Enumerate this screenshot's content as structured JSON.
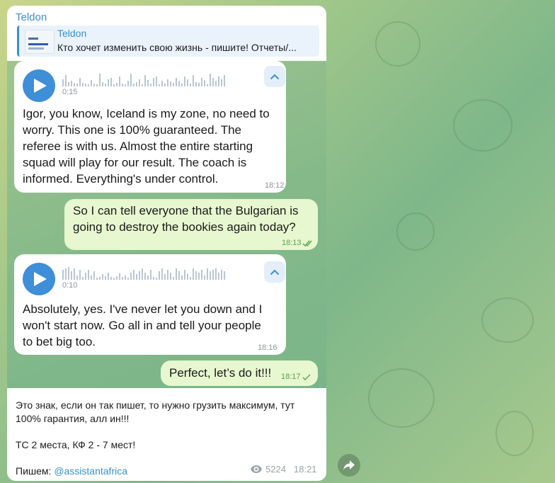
{
  "post": {
    "channel": "Teldon",
    "quote_title": "Teldon",
    "quote_text": "Кто хочет изменить свою жизнь - пишите!  Отчеты/...",
    "body_line1": "Это знак, если он так пишет, то нужно грузить максимум, тут",
    "body_line2": "100% гарантия, алл ин!!!",
    "body_line3": "ТС 2 места, КФ 2 - 7 мест!",
    "contact_prefix": "Пишем: ",
    "contact_handle": "@assistantafrica",
    "views": "5224",
    "time": "18:21"
  },
  "chat": {
    "voice1": {
      "duration": "0:15",
      "line1": "Igor, you know, Iceland is my zone, no need to",
      "line2": "worry. This one is 100% guaranteed. The",
      "line3": "referee is with us. Almost the entire starting",
      "line4": "squad will play for our result. The coach is",
      "line5": "informed. Everything's under control.",
      "time": "18:12"
    },
    "out1": {
      "line1": "So I can tell everyone that the Bulgarian is",
      "line2": "going to destroy the bookies again today?",
      "time": "18:13"
    },
    "voice2": {
      "duration": "0:10",
      "line1": "Absolutely, yes. I've never let you down and I",
      "line2": "won't start now. Go all in and tell your people",
      "line3": "to bet big too.",
      "time": "18:16"
    },
    "out2": {
      "text": "Perfect, let’s do it!!!",
      "time": "18:17"
    }
  },
  "icons": {
    "play": "play-icon",
    "collapse": "chevron-up-icon",
    "read": "double-check-icon",
    "sent": "check-icon",
    "views": "eye-icon",
    "share": "share-arrow-icon"
  },
  "colors": {
    "accent": "#3a8fd1",
    "outgoing_bubble": "#e7f7cf",
    "incoming_bubble": "#ffffff",
    "checkmark": "#5aa34f"
  }
}
